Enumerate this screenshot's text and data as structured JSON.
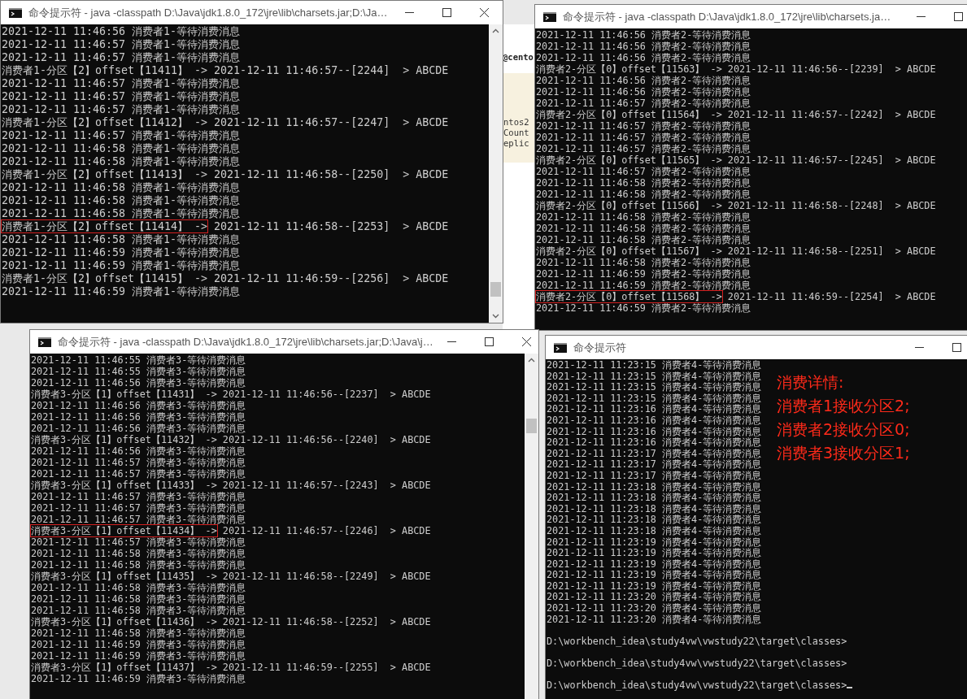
{
  "background_fragments": [
    "@cento",
    "ntos2",
    "Count",
    "eplic"
  ],
  "windows": [
    {
      "title": "命令提示符 - java  -classpath D:\\Java\\jdk1.8.0_172\\jre\\lib\\charsets.jar;D:\\Ja…",
      "has_close": true,
      "scrollbar": true,
      "lines": [
        {
          "kind": "wait",
          "text": "2021-12-11 11:46:56 消费者1-等待消费消息"
        },
        {
          "kind": "wait",
          "text": "2021-12-11 11:46:57 消费者1-等待消费消息"
        },
        {
          "kind": "wait",
          "text": "2021-12-11 11:46:57 消费者1-等待消费消息"
        },
        {
          "kind": "partition",
          "head": "消费者1-分区【2】offset【11411】 ->",
          "tail": " 2021-12-11 11:46:57--[2244]  > ABCDE",
          "boxed": false
        },
        {
          "kind": "wait",
          "text": "2021-12-11 11:46:57 消费者1-等待消费消息"
        },
        {
          "kind": "wait",
          "text": "2021-12-11 11:46:57 消费者1-等待消费消息"
        },
        {
          "kind": "wait",
          "text": "2021-12-11 11:46:57 消费者1-等待消费消息"
        },
        {
          "kind": "partition",
          "head": "消费者1-分区【2】offset【11412】 ->",
          "tail": " 2021-12-11 11:46:57--[2247]  > ABCDE",
          "boxed": false
        },
        {
          "kind": "wait",
          "text": "2021-12-11 11:46:57 消费者1-等待消费消息"
        },
        {
          "kind": "wait",
          "text": "2021-12-11 11:46:58 消费者1-等待消费消息"
        },
        {
          "kind": "wait",
          "text": "2021-12-11 11:46:58 消费者1-等待消费消息"
        },
        {
          "kind": "partition",
          "head": "消费者1-分区【2】offset【11413】 ->",
          "tail": " 2021-12-11 11:46:58--[2250]  > ABCDE",
          "boxed": false
        },
        {
          "kind": "wait",
          "text": "2021-12-11 11:46:58 消费者1-等待消费消息"
        },
        {
          "kind": "wait",
          "text": "2021-12-11 11:46:58 消费者1-等待消费消息"
        },
        {
          "kind": "wait",
          "text": "2021-12-11 11:46:58 消费者1-等待消费消息"
        },
        {
          "kind": "partition",
          "head": "消费者1-分区【2】offset【11414】 ->",
          "tail": " 2021-12-11 11:46:58--[2253]  > ABCDE",
          "boxed": true
        },
        {
          "kind": "wait",
          "text": "2021-12-11 11:46:58 消费者1-等待消费消息"
        },
        {
          "kind": "wait",
          "text": "2021-12-11 11:46:59 消费者1-等待消费消息"
        },
        {
          "kind": "wait",
          "text": "2021-12-11 11:46:59 消费者1-等待消费消息"
        },
        {
          "kind": "partition",
          "head": "消费者1-分区【2】offset【11415】 ->",
          "tail": " 2021-12-11 11:46:59--[2256]  > ABCDE",
          "boxed": false
        },
        {
          "kind": "wait",
          "text": "2021-12-11 11:46:59 消费者1-等待消费消息"
        }
      ]
    },
    {
      "title": "命令提示符 - java  -classpath D:\\Java\\jdk1.8.0_172\\jre\\lib\\charsets.ja…",
      "has_close": false,
      "scrollbar": false,
      "lines": [
        {
          "kind": "wait",
          "text": "2021-12-11 11:46:56 消费者2-等待消费消息"
        },
        {
          "kind": "wait",
          "text": "2021-12-11 11:46:56 消费者2-等待消费消息"
        },
        {
          "kind": "wait",
          "text": "2021-12-11 11:46:56 消费者2-等待消费消息"
        },
        {
          "kind": "partition",
          "head": "消费者2-分区【0】offset【11563】 ->",
          "tail": " 2021-12-11 11:46:56--[2239]  > ABCDE",
          "boxed": false
        },
        {
          "kind": "wait",
          "text": "2021-12-11 11:46:56 消费者2-等待消费消息"
        },
        {
          "kind": "wait",
          "text": "2021-12-11 11:46:56 消费者2-等待消费消息"
        },
        {
          "kind": "wait",
          "text": "2021-12-11 11:46:57 消费者2-等待消费消息"
        },
        {
          "kind": "partition",
          "head": "消费者2-分区【0】offset【11564】 ->",
          "tail": " 2021-12-11 11:46:57--[2242]  > ABCDE",
          "boxed": false
        },
        {
          "kind": "wait",
          "text": "2021-12-11 11:46:57 消费者2-等待消费消息"
        },
        {
          "kind": "wait",
          "text": "2021-12-11 11:46:57 消费者2-等待消费消息"
        },
        {
          "kind": "wait",
          "text": "2021-12-11 11:46:57 消费者2-等待消费消息"
        },
        {
          "kind": "partition",
          "head": "消费者2-分区【0】offset【11565】 ->",
          "tail": " 2021-12-11 11:46:57--[2245]  > ABCDE",
          "boxed": false
        },
        {
          "kind": "wait",
          "text": "2021-12-11 11:46:57 消费者2-等待消费消息"
        },
        {
          "kind": "wait",
          "text": "2021-12-11 11:46:58 消费者2-等待消费消息"
        },
        {
          "kind": "wait",
          "text": "2021-12-11 11:46:58 消费者2-等待消费消息"
        },
        {
          "kind": "partition",
          "head": "消费者2-分区【0】offset【11566】 ->",
          "tail": " 2021-12-11 11:46:58--[2248]  > ABCDE",
          "boxed": false
        },
        {
          "kind": "wait",
          "text": "2021-12-11 11:46:58 消费者2-等待消费消息"
        },
        {
          "kind": "wait",
          "text": "2021-12-11 11:46:58 消费者2-等待消费消息"
        },
        {
          "kind": "wait",
          "text": "2021-12-11 11:46:58 消费者2-等待消费消息"
        },
        {
          "kind": "partition",
          "head": "消费者2-分区【0】offset【11567】 ->",
          "tail": " 2021-12-11 11:46:58--[2251]  > ABCDE",
          "boxed": false
        },
        {
          "kind": "wait",
          "text": "2021-12-11 11:46:58 消费者2-等待消费消息"
        },
        {
          "kind": "wait",
          "text": "2021-12-11 11:46:59 消费者2-等待消费消息"
        },
        {
          "kind": "wait",
          "text": "2021-12-11 11:46:59 消费者2-等待消费消息"
        },
        {
          "kind": "partition",
          "head": "消费者2-分区【0】offset【11568】 ->",
          "tail": " 2021-12-11 11:46:59--[2254]  > ABCDE",
          "boxed": true
        },
        {
          "kind": "wait",
          "text": "2021-12-11 11:46:59 消费者2-等待消费消息"
        }
      ]
    },
    {
      "title": "命令提示符 - java  -classpath D:\\Java\\jdk1.8.0_172\\jre\\lib\\charsets.jar;D:\\Java\\j…",
      "has_close": true,
      "scrollbar": true,
      "lines": [
        {
          "kind": "wait",
          "text": "2021-12-11 11:46:55 消费者3-等待消费消息"
        },
        {
          "kind": "wait",
          "text": "2021-12-11 11:46:55 消费者3-等待消费消息"
        },
        {
          "kind": "wait",
          "text": "2021-12-11 11:46:56 消费者3-等待消费消息"
        },
        {
          "kind": "partition",
          "head": "消费者3-分区【1】offset【11431】 ->",
          "tail": " 2021-12-11 11:46:56--[2237]  > ABCDE",
          "boxed": false
        },
        {
          "kind": "wait",
          "text": "2021-12-11 11:46:56 消费者3-等待消费消息"
        },
        {
          "kind": "wait",
          "text": "2021-12-11 11:46:56 消费者3-等待消费消息"
        },
        {
          "kind": "wait",
          "text": "2021-12-11 11:46:56 消费者3-等待消费消息"
        },
        {
          "kind": "partition",
          "head": "消费者3-分区【1】offset【11432】 ->",
          "tail": " 2021-12-11 11:46:56--[2240]  > ABCDE",
          "boxed": false
        },
        {
          "kind": "wait",
          "text": "2021-12-11 11:46:56 消费者3-等待消费消息"
        },
        {
          "kind": "wait",
          "text": "2021-12-11 11:46:57 消费者3-等待消费消息"
        },
        {
          "kind": "wait",
          "text": "2021-12-11 11:46:57 消费者3-等待消费消息"
        },
        {
          "kind": "partition",
          "head": "消费者3-分区【1】offset【11433】 ->",
          "tail": " 2021-12-11 11:46:57--[2243]  > ABCDE",
          "boxed": false
        },
        {
          "kind": "wait",
          "text": "2021-12-11 11:46:57 消费者3-等待消费消息"
        },
        {
          "kind": "wait",
          "text": "2021-12-11 11:46:57 消费者3-等待消费消息"
        },
        {
          "kind": "wait",
          "text": "2021-12-11 11:46:57 消费者3-等待消费消息"
        },
        {
          "kind": "partition",
          "head": "消费者3-分区【1】offset【11434】 ->",
          "tail": " 2021-12-11 11:46:57--[2246]  > ABCDE",
          "boxed": true
        },
        {
          "kind": "wait",
          "text": "2021-12-11 11:46:57 消费者3-等待消费消息"
        },
        {
          "kind": "wait",
          "text": "2021-12-11 11:46:58 消费者3-等待消费消息"
        },
        {
          "kind": "wait",
          "text": "2021-12-11 11:46:58 消费者3-等待消费消息"
        },
        {
          "kind": "partition",
          "head": "消费者3-分区【1】offset【11435】 ->",
          "tail": " 2021-12-11 11:46:58--[2249]  > ABCDE",
          "boxed": false
        },
        {
          "kind": "wait",
          "text": "2021-12-11 11:46:58 消费者3-等待消费消息"
        },
        {
          "kind": "wait",
          "text": "2021-12-11 11:46:58 消费者3-等待消费消息"
        },
        {
          "kind": "wait",
          "text": "2021-12-11 11:46:58 消费者3-等待消费消息"
        },
        {
          "kind": "partition",
          "head": "消费者3-分区【1】offset【11436】 ->",
          "tail": " 2021-12-11 11:46:58--[2252]  > ABCDE",
          "boxed": false
        },
        {
          "kind": "wait",
          "text": "2021-12-11 11:46:58 消费者3-等待消费消息"
        },
        {
          "kind": "wait",
          "text": "2021-12-11 11:46:59 消费者3-等待消费消息"
        },
        {
          "kind": "wait",
          "text": "2021-12-11 11:46:59 消费者3-等待消费消息"
        },
        {
          "kind": "partition",
          "head": "消费者3-分区【1】offset【11437】 ->",
          "tail": " 2021-12-11 11:46:59--[2255]  > ABCDE",
          "boxed": false
        },
        {
          "kind": "wait",
          "text": "2021-12-11 11:46:59 消费者3-等待消费消息"
        }
      ]
    },
    {
      "title": "命令提示符",
      "has_close": false,
      "scrollbar": false,
      "annotation": [
        "消费详情:",
        "消费者1接收分区2;",
        "消费者2接收分区0;",
        "消费者3接收分区1;"
      ],
      "lines": [
        {
          "kind": "wait",
          "text": "2021-12-11 11:23:15 消费者4-等待消费消息"
        },
        {
          "kind": "wait",
          "text": "2021-12-11 11:23:15 消费者4-等待消费消息"
        },
        {
          "kind": "wait",
          "text": "2021-12-11 11:23:15 消费者4-等待消费消息"
        },
        {
          "kind": "wait",
          "text": "2021-12-11 11:23:15 消费者4-等待消费消息"
        },
        {
          "kind": "wait",
          "text": "2021-12-11 11:23:16 消费者4-等待消费消息"
        },
        {
          "kind": "wait",
          "text": "2021-12-11 11:23:16 消费者4-等待消费消息"
        },
        {
          "kind": "wait",
          "text": "2021-12-11 11:23:16 消费者4-等待消费消息"
        },
        {
          "kind": "wait",
          "text": "2021-12-11 11:23:16 消费者4-等待消费消息"
        },
        {
          "kind": "wait",
          "text": "2021-12-11 11:23:17 消费者4-等待消费消息"
        },
        {
          "kind": "wait",
          "text": "2021-12-11 11:23:17 消费者4-等待消费消息"
        },
        {
          "kind": "wait",
          "text": "2021-12-11 11:23:17 消费者4-等待消费消息"
        },
        {
          "kind": "wait",
          "text": "2021-12-11 11:23:18 消费者4-等待消费消息"
        },
        {
          "kind": "wait",
          "text": "2021-12-11 11:23:18 消费者4-等待消费消息"
        },
        {
          "kind": "wait",
          "text": "2021-12-11 11:23:18 消费者4-等待消费消息"
        },
        {
          "kind": "wait",
          "text": "2021-12-11 11:23:18 消费者4-等待消费消息"
        },
        {
          "kind": "wait",
          "text": "2021-12-11 11:23:18 消费者4-等待消费消息"
        },
        {
          "kind": "wait",
          "text": "2021-12-11 11:23:19 消费者4-等待消费消息"
        },
        {
          "kind": "wait",
          "text": "2021-12-11 11:23:19 消费者4-等待消费消息"
        },
        {
          "kind": "wait",
          "text": "2021-12-11 11:23:19 消费者4-等待消费消息"
        },
        {
          "kind": "wait",
          "text": "2021-12-11 11:23:19 消费者4-等待消费消息"
        },
        {
          "kind": "wait",
          "text": "2021-12-11 11:23:19 消费者4-等待消费消息"
        },
        {
          "kind": "wait",
          "text": "2021-12-11 11:23:20 消费者4-等待消费消息"
        },
        {
          "kind": "wait",
          "text": "2021-12-11 11:23:20 消费者4-等待消费消息"
        },
        {
          "kind": "wait",
          "text": "2021-12-11 11:23:20 消费者4-等待消费消息"
        },
        {
          "kind": "blank"
        },
        {
          "kind": "prompt",
          "text": "D:\\workbench_idea\\study4vw\\vwstudy22\\target\\classes>",
          "cursor": false
        },
        {
          "kind": "blank"
        },
        {
          "kind": "prompt",
          "text": "D:\\workbench_idea\\study4vw\\vwstudy22\\target\\classes>",
          "cursor": false
        },
        {
          "kind": "blank"
        },
        {
          "kind": "prompt",
          "text": "D:\\workbench_idea\\study4vw\\vwstudy22\\target\\classes>",
          "cursor": true
        }
      ]
    }
  ]
}
